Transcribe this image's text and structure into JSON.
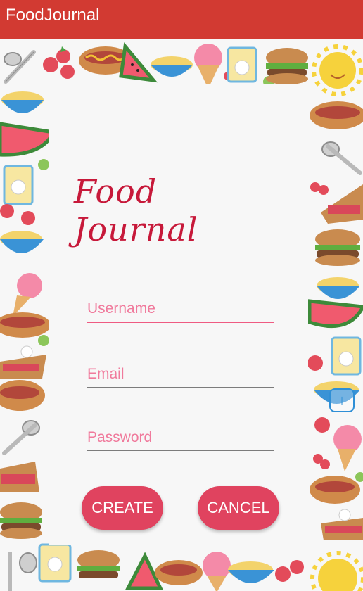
{
  "app": {
    "title": "FoodJournal"
  },
  "brand": {
    "title": "Food Journal"
  },
  "form": {
    "username": {
      "placeholder": "Username",
      "value": ""
    },
    "email": {
      "placeholder": "Email",
      "value": ""
    },
    "password": {
      "placeholder": "Password",
      "value": ""
    }
  },
  "buttons": {
    "create": "CREATE",
    "cancel": "CANCEL"
  },
  "colors": {
    "app_bar": "#d23a32",
    "brand_text": "#c7193a",
    "hint_text": "#f07a9c",
    "button": "#e0435f"
  },
  "decor": {
    "icons": [
      "fork-spoon-icon",
      "strawberry-icon",
      "hotdog-icon",
      "watermelon-icon",
      "bowl-icon",
      "icecream-icon",
      "drink-icon",
      "burger-icon",
      "sun-icon",
      "pie-icon",
      "cherries-icon",
      "pea-icon"
    ]
  }
}
